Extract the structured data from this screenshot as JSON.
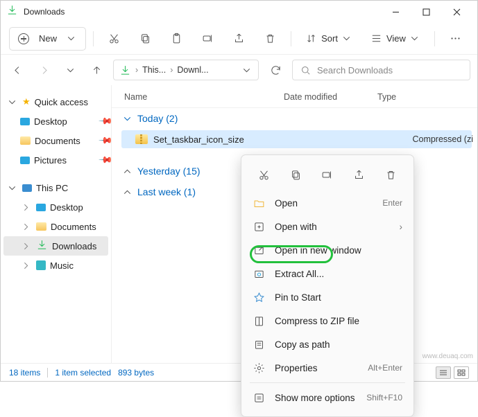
{
  "window": {
    "title": "Downloads"
  },
  "toolbar": {
    "new_label": "New",
    "sort_label": "Sort",
    "view_label": "View"
  },
  "address": {
    "crumb1": "This...",
    "crumb2": "Downl..."
  },
  "search": {
    "placeholder": "Search Downloads"
  },
  "columns": {
    "name": "Name",
    "date": "Date modified",
    "type": "Type"
  },
  "groups": {
    "today": {
      "label": "Today (2)"
    },
    "yesterday": {
      "label": "Yesterday (15)"
    },
    "lastweek": {
      "label": "Last week (1)"
    }
  },
  "files": {
    "item0": {
      "name": "Set_taskbar_icon_size",
      "type": "Compressed (zi"
    }
  },
  "sidebar": {
    "quick_access": "Quick access",
    "desktop": "Desktop",
    "documents": "Documents",
    "pictures": "Pictures",
    "this_pc": "This PC",
    "desktop2": "Desktop",
    "documents2": "Documents",
    "downloads": "Downloads",
    "music": "Music"
  },
  "context": {
    "open": "Open",
    "open_hint": "Enter",
    "open_with": "Open with",
    "open_new_window": "Open in new window",
    "extract_all": "Extract All...",
    "pin_to_start": "Pin to Start",
    "compress": "Compress to ZIP file",
    "copy_path": "Copy as path",
    "properties": "Properties",
    "properties_hint": "Alt+Enter",
    "show_more": "Show more options",
    "show_more_hint": "Shift+F10"
  },
  "status": {
    "count": "18 items",
    "selected": "1 item selected",
    "size": "893 bytes"
  },
  "watermark": "www.deuaq.com"
}
